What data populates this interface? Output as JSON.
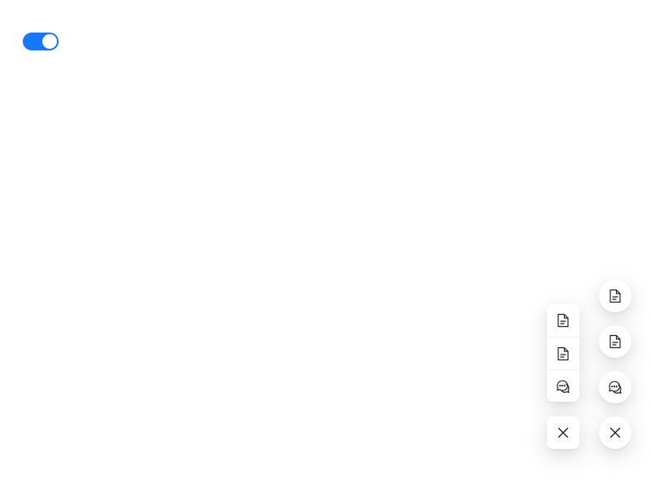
{
  "toggle": {
    "checked": true,
    "color": "#1677ff"
  },
  "float_group_square": {
    "items": [
      {
        "icon": "file-text-icon"
      },
      {
        "icon": "file-text-icon"
      },
      {
        "icon": "comment-icon"
      }
    ],
    "close_icon": "close-icon"
  },
  "float_group_circle": {
    "items": [
      {
        "icon": "file-text-icon"
      },
      {
        "icon": "file-text-icon"
      },
      {
        "icon": "comment-icon"
      }
    ],
    "close_icon": "close-icon"
  },
  "colors": {
    "icon": "#1f1f1f",
    "primary": "#1677ff"
  }
}
